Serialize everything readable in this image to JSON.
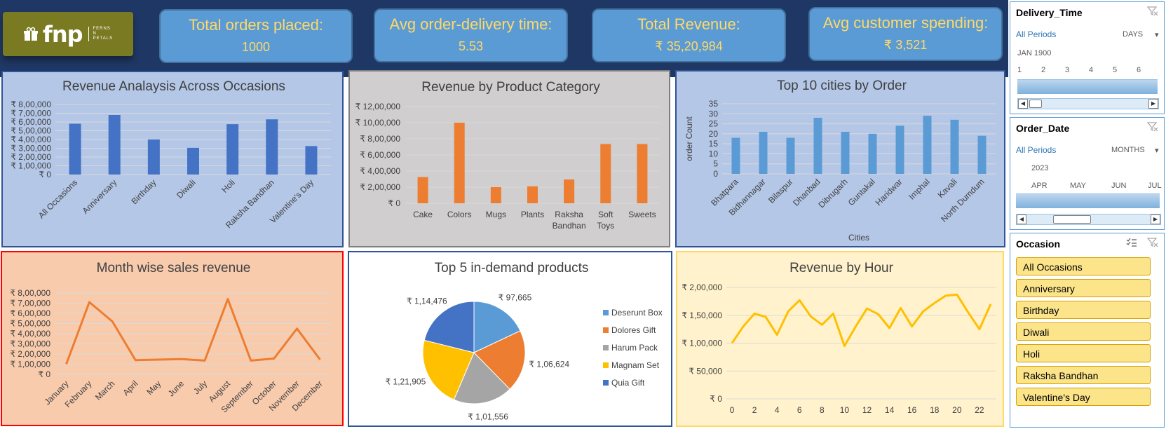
{
  "logo": {
    "brand": "fnp",
    "sub": [
      "FERNS",
      "N",
      "PETALS"
    ]
  },
  "kpis": [
    {
      "title": "Total orders placed:",
      "value": "1000"
    },
    {
      "title": "Avg order-delivery time:",
      "value": "5.53"
    },
    {
      "title": "Total Revenue:",
      "value": "₹ 35,20,984"
    },
    {
      "title": "Avg customer spending:",
      "value": "₹ 3,521"
    }
  ],
  "chart_data": [
    {
      "type": "bar",
      "title": "Revenue Analaysis Across Occasions",
      "categories": [
        "All Occasions",
        "Anniversary",
        "Birthday",
        "Diwali",
        "Holi",
        "Raksha Bandhan",
        "Valentine's Day"
      ],
      "values": [
        580000,
        680000,
        400000,
        305000,
        575000,
        630000,
        325000
      ],
      "yticks": [
        "₹ 0",
        "₹ 1,00,000",
        "₹ 2,00,000",
        "₹ 3,00,000",
        "₹ 4,00,000",
        "₹ 5,00,000",
        "₹ 6,00,000",
        "₹ 7,00,000",
        "₹ 8,00,000"
      ],
      "ylim": [
        0,
        800000
      ],
      "color": "#4472c4",
      "background": "#b4c7e7"
    },
    {
      "type": "bar",
      "title": "Revenue by Product Category",
      "categories": [
        "Cake",
        "Colors",
        "Mugs",
        "Plants",
        "Raksha Bandhan",
        "Soft Toys",
        "Sweets"
      ],
      "values": [
        325000,
        1000000,
        200000,
        210000,
        295000,
        735000,
        735000
      ],
      "yticks": [
        "₹ 0",
        "₹ 2,00,000",
        "₹ 4,00,000",
        "₹ 6,00,000",
        "₹ 8,00,000",
        "₹ 10,00,000",
        "₹ 12,00,000"
      ],
      "ylim": [
        0,
        1200000
      ],
      "color": "#ed7d31",
      "background": "#d0cece"
    },
    {
      "type": "bar",
      "title": "Top 10 cities by Order",
      "xlabel": "Cities",
      "ylabel": "order Count",
      "categories": [
        "Bhatpara",
        "Bidhannagar",
        "Bilaspur",
        "Dhanbad",
        "Dibrugarh",
        "Guntakal",
        "Haridwar",
        "Imphal",
        "Kavali",
        "North Dumdum"
      ],
      "values": [
        18,
        21,
        18,
        28,
        21,
        20,
        24,
        29,
        27,
        19
      ],
      "yticks": [
        "0",
        "5",
        "10",
        "15",
        "20",
        "25",
        "30",
        "35"
      ],
      "ylim": [
        0,
        35
      ],
      "color": "#5b9bd5",
      "background": "#b4c7e7"
    },
    {
      "type": "line",
      "title": "Month wise sales revenue",
      "categories": [
        "January",
        "February",
        "March",
        "April",
        "May",
        "June",
        "July",
        "August",
        "September",
        "October",
        "November",
        "December"
      ],
      "values": [
        100000,
        710000,
        520000,
        140000,
        145000,
        150000,
        135000,
        740000,
        135000,
        155000,
        450000,
        145000
      ],
      "yticks": [
        "₹ 0",
        "₹ 1,00,000",
        "₹ 2,00,000",
        "₹ 3,00,000",
        "₹ 4,00,000",
        "₹ 5,00,000",
        "₹ 6,00,000",
        "₹ 7,00,000",
        "₹ 8,00,000"
      ],
      "ylim": [
        0,
        800000
      ],
      "color": "#ed7d31",
      "background": "#f8cbad"
    },
    {
      "type": "pie",
      "title": "Top 5 in-demand products",
      "series": [
        {
          "name": "Deserunt Box",
          "value": 97665,
          "label": "₹ 97,665",
          "color": "#5b9bd5"
        },
        {
          "name": "Dolores Gift",
          "value": 106624,
          "label": "₹ 1,06,624",
          "color": "#ed7d31"
        },
        {
          "name": "Harum Pack",
          "value": 101556,
          "label": "₹ 1,01,556",
          "color": "#a5a5a5"
        },
        {
          "name": "Magnam Set",
          "value": 121905,
          "label": "₹ 1,21,905",
          "color": "#ffc000"
        },
        {
          "name": "Quia Gift",
          "value": 114476,
          "label": "₹ 1,14,476",
          "color": "#4472c4"
        }
      ],
      "legend": "right"
    },
    {
      "type": "line",
      "title": "Revenue by Hour",
      "x": [
        0,
        1,
        2,
        3,
        4,
        5,
        6,
        7,
        8,
        9,
        10,
        11,
        12,
        13,
        14,
        15,
        16,
        17,
        18,
        19,
        20,
        21,
        22,
        23
      ],
      "xticks": [
        "0",
        "2",
        "4",
        "6",
        "8",
        "10",
        "12",
        "14",
        "16",
        "18",
        "20",
        "22"
      ],
      "values": [
        100000,
        130000,
        153000,
        147000,
        115000,
        157000,
        177000,
        148000,
        133000,
        153000,
        95000,
        130000,
        162000,
        152000,
        127000,
        163000,
        130000,
        157000,
        172000,
        185000,
        187000,
        155000,
        125000,
        170000
      ],
      "yticks": [
        "₹ 0",
        "₹ 50,000",
        "₹ 1,00,000",
        "₹ 1,50,000",
        "₹ 2,00,000"
      ],
      "ylim": [
        0,
        200000
      ],
      "color": "#ffc000",
      "background": "#fff2cc"
    }
  ],
  "slicers": {
    "delivery": {
      "title": "Delivery_Time",
      "all": "All Periods",
      "unit": "DAYS",
      "period": "JAN 1900",
      "ticks": [
        "1",
        "2",
        "3",
        "4",
        "5",
        "6"
      ]
    },
    "order": {
      "title": "Order_Date",
      "all": "All Periods",
      "unit": "MONTHS",
      "period": "2023",
      "ticks": [
        "APR",
        "MAY",
        "JUN",
        "JUL"
      ]
    },
    "occasion": {
      "title": "Occasion",
      "items": [
        "All Occasions",
        "Anniversary",
        "Birthday",
        "Diwali",
        "Holi",
        "Raksha Bandhan",
        "Valentine's Day"
      ]
    }
  }
}
